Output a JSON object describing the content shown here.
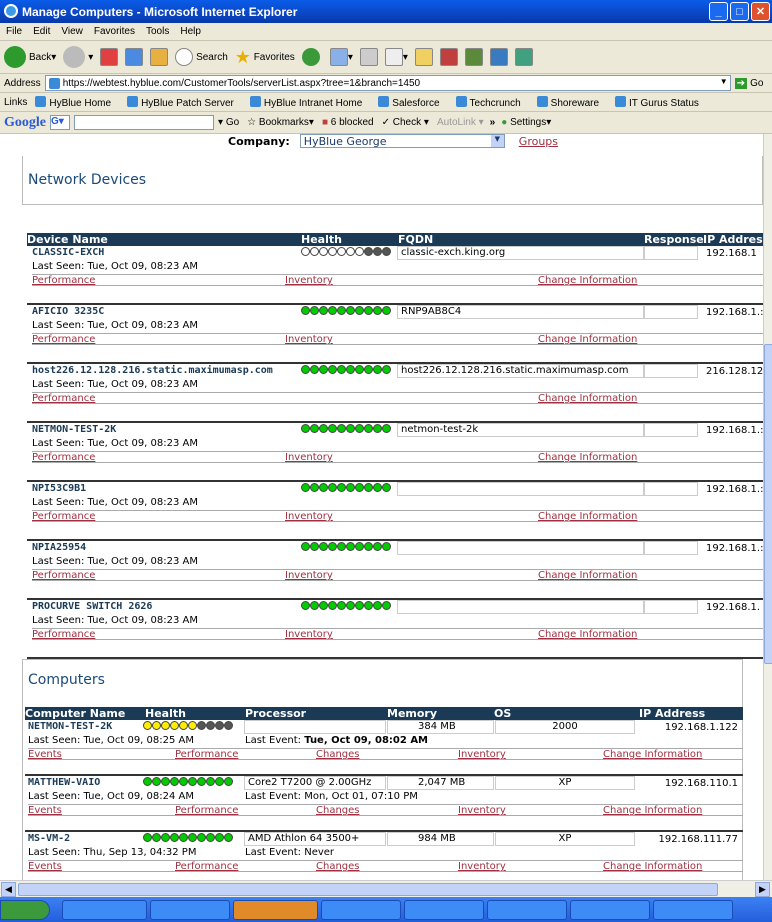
{
  "window": {
    "title": "Manage Computers - Microsoft Internet Explorer"
  },
  "menu": [
    "File",
    "Edit",
    "View",
    "Favorites",
    "Tools",
    "Help"
  ],
  "toolbar": {
    "back": "Back",
    "search": "Search",
    "favorites": "Favorites"
  },
  "address": {
    "label": "Address",
    "url": "https://webtest.hyblue.com/CustomerTools/serverList.aspx?tree=1&branch=1450",
    "go": "Go"
  },
  "links": {
    "label": "Links",
    "items": [
      "HyBlue Home",
      "HyBlue Patch Server",
      "HyBlue Intranet Home",
      "Salesforce",
      "Techcrunch",
      "Shoreware",
      "IT Gurus Status"
    ]
  },
  "google": {
    "brand": "Google",
    "go": "Go",
    "bookmarks": "Bookmarks",
    "blocked": "6 blocked",
    "check": "Check",
    "autolink": "AutoLink",
    "more": "»",
    "settings": "Settings"
  },
  "company": {
    "label": "Company:",
    "value": "HyBlue George",
    "groups": "Groups"
  },
  "network": {
    "title": "Network Devices",
    "headers": {
      "name": "Device Name",
      "health": "Health",
      "fqdn": "FQDN",
      "response": "Response",
      "ip": "IP Address"
    },
    "devices": [
      {
        "name": "CLASSIC-EXCH",
        "fqdn": "classic-exch.king.org",
        "ip": "192.168.1",
        "seen": "Last Seen:  Tue, Oct 09, 08:23 AM",
        "health": "wwwwwwwkkk",
        "links": [
          "Performance",
          "Inventory",
          "Change Information"
        ]
      },
      {
        "name": "AFICIO 3235C",
        "fqdn": "RNP9AB8C4",
        "ip": "192.168.1.:",
        "seen": "Last Seen:  Tue, Oct 09, 08:23 AM",
        "health": "gggggggggg",
        "links": [
          "Performance",
          "Inventory",
          "Change Information"
        ]
      },
      {
        "name": "host226.12.128.216.static.maximumasp.com",
        "fqdn": "host226.12.128.216.static.maximumasp.com",
        "ip": "216.128.12.",
        "seen": "Last Seen:  Tue, Oct 09, 08:23 AM",
        "health": "gggggggggg",
        "links": [
          "Performance",
          "",
          "Change Information"
        ]
      },
      {
        "name": "NETMON-TEST-2K",
        "fqdn": "netmon-test-2k",
        "ip": "192.168.1.:",
        "seen": "Last Seen:  Tue, Oct 09, 08:23 AM",
        "health": "gggggggggg",
        "links": [
          "Performance",
          "Inventory",
          "Change Information"
        ]
      },
      {
        "name": "NPI53C9B1",
        "fqdn": "",
        "ip": "192.168.1.:",
        "seen": "Last Seen:  Tue, Oct 09, 08:23 AM",
        "health": "gggggggggg",
        "links": [
          "Performance",
          "Inventory",
          "Change Information"
        ]
      },
      {
        "name": "NPIA25954",
        "fqdn": "",
        "ip": "192.168.1.:",
        "seen": "Last Seen:  Tue, Oct 09, 08:23 AM",
        "health": "gggggggggg",
        "links": [
          "Performance",
          "Inventory",
          "Change Information"
        ]
      },
      {
        "name": "PROCURVE SWITCH 2626",
        "fqdn": "",
        "ip": "192.168.1.",
        "seen": "Last Seen:  Tue, Oct 09, 08:23 AM",
        "health": "gggggggggg",
        "links": [
          "Performance",
          "Inventory",
          "Change Information"
        ]
      }
    ]
  },
  "computers": {
    "title": "Computers",
    "headers": {
      "name": "Computer Name",
      "health": "Health",
      "processor": "Processor",
      "memory": "Memory",
      "os": "OS",
      "ip": "IP Address"
    },
    "items": [
      {
        "name": "NETMON-TEST-2K",
        "health": "yyyyyykkkk",
        "processor": "",
        "memory": "384 MB",
        "os": "2000",
        "ip": "192.168.1.122",
        "seen": "Last Seen:  Tue, Oct 09, 08:25 AM",
        "event_label": "Last Event:",
        "event": "Tue, Oct 09, 08:02 AM",
        "bold": true,
        "links": [
          "Events",
          "Performance",
          "Changes",
          "Inventory",
          "Change Information"
        ]
      },
      {
        "name": "MATTHEW-VAIO",
        "health": "gggggggggg",
        "processor": "Core2 T7200 @ 2.00GHz",
        "memory": "2,047 MB",
        "os": "XP",
        "ip": "192.168.110.1",
        "seen": "Last Seen:  Tue, Oct 09, 08:24 AM",
        "event_label": "Last Event:",
        "event": "Mon, Oct 01, 07:10 PM",
        "bold": false,
        "links": [
          "Events",
          "Performance",
          "Changes",
          "Inventory",
          "Change Information"
        ]
      },
      {
        "name": "MS-VM-2",
        "health": "gggggggggg",
        "processor": "AMD Athlon 64 3500+",
        "memory": "984 MB",
        "os": "XP",
        "ip": "192.168.111.77",
        "seen": "Last Seen:  Thu, Sep 13, 04:32 PM",
        "event_label": "Last Event:",
        "event": "Never",
        "bold": false,
        "links": [
          "Events",
          "Performance",
          "Changes",
          "Inventory",
          "Change Information"
        ]
      }
    ]
  }
}
